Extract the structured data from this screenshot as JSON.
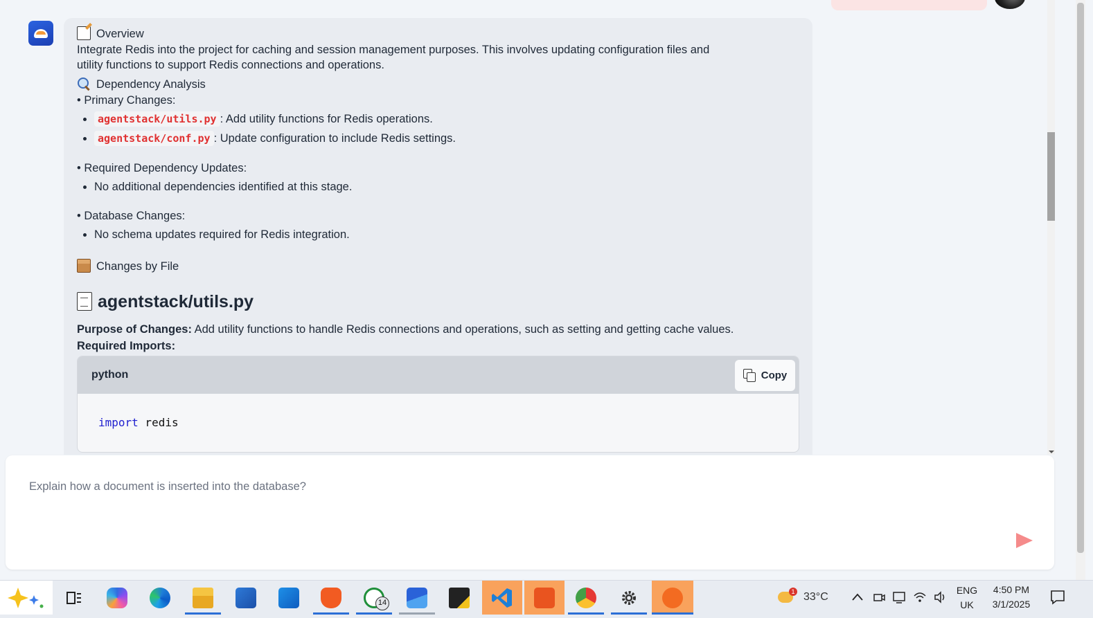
{
  "message": {
    "overview_heading": "Overview",
    "overview_text_1": "Integrate Redis into the project for caching and session management purposes. This involves updating configuration files and",
    "overview_text_2": "utility functions to support Redis connections and operations.",
    "dependency_heading": "Dependency Analysis",
    "primary_changes_label": "• Primary Changes:",
    "primary_changes": [
      {
        "file": "agentstack/utils.py",
        "desc": ": Add utility functions for Redis operations."
      },
      {
        "file": "agentstack/conf.py",
        "desc": ": Update configuration to include Redis settings."
      }
    ],
    "required_updates_label": "• Required Dependency Updates:",
    "required_updates": [
      "No additional dependencies identified at this stage."
    ],
    "database_changes_label": "• Database Changes:",
    "database_changes": [
      "No schema updates required for Redis integration."
    ],
    "changes_by_file_heading": "Changes by File",
    "file_heading": "agentstack/utils.py",
    "purpose_label": "Purpose of Changes:",
    "purpose_text": " Add utility functions to handle Redis connections and operations, such as setting and getting cache values.",
    "required_imports_label": "Required Imports:",
    "code_block": {
      "language": "python",
      "copy_label": "Copy",
      "code_keyword": "import",
      "code_rest": " redis"
    }
  },
  "input": {
    "placeholder": "Explain how a document is inserted into the database?"
  },
  "taskbar": {
    "apps": [
      "copilot-sparkle",
      "task-view",
      "copilot",
      "edge",
      "file-explorer",
      "microsoft-store",
      "outlook",
      "brave",
      "whatsapp",
      "mail",
      "sticky-app",
      "vscode",
      "ubuntu",
      "chrome",
      "settings",
      "drawing-app"
    ],
    "whatsapp_badge": "14",
    "weather_badge": "1",
    "temperature": "33°C",
    "language_1": "ENG",
    "language_2": "UK",
    "time": "4:50 PM",
    "date": "3/1/2025"
  }
}
